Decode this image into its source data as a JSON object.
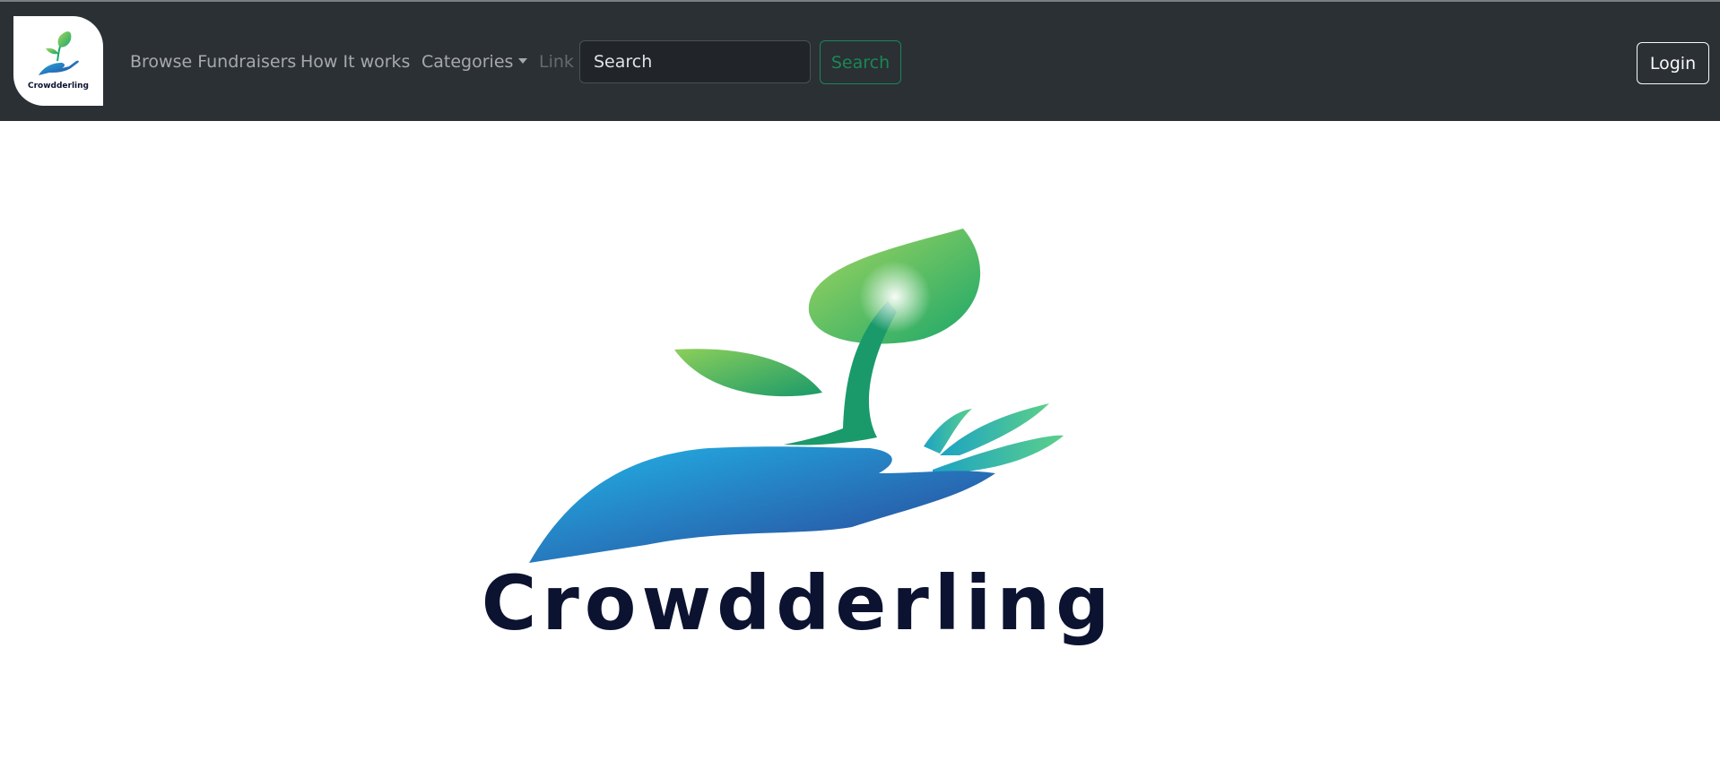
{
  "brand": {
    "logo_text": "Crowdderling",
    "colors": {
      "leaf_light": "#a4d65e",
      "leaf_dark": "#1aa76a",
      "hand_light": "#22b5e8",
      "hand_dark": "#2a3f94",
      "wordmark": "#0c1331"
    }
  },
  "navbar": {
    "links": [
      {
        "label": "Browse Fundraisers"
      },
      {
        "label": "How It works"
      },
      {
        "label": "Categories"
      },
      {
        "label": "Link"
      }
    ],
    "search": {
      "placeholder": "Search",
      "button_label": "Search"
    },
    "login_label": "Login",
    "colors": {
      "background": "#2b3035",
      "search_accent": "#198754"
    }
  },
  "hero": {
    "wordmark": "Crowdderling"
  }
}
